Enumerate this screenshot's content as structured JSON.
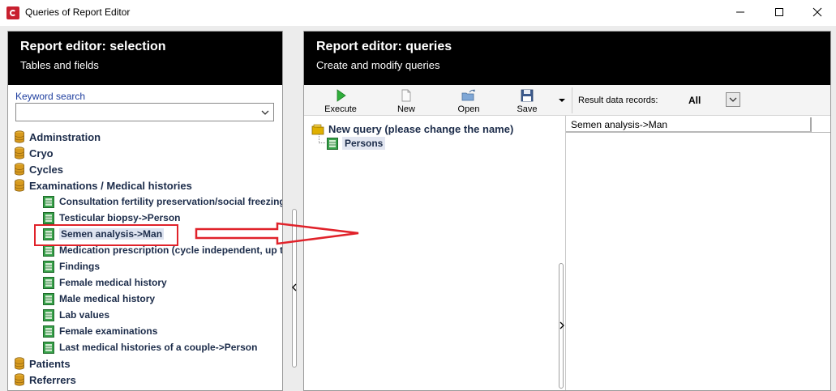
{
  "window": {
    "title": "Queries of Report Editor"
  },
  "left_panel": {
    "header_title": "Report editor: selection",
    "header_subtitle": "Tables and fields",
    "keyword_label": "Keyword search",
    "keyword_value": "",
    "tree": {
      "groups_top": [
        "Adminstration",
        "Cryo",
        "Cycles",
        "Examinations / Medical histories"
      ],
      "examination_tables": [
        "Consultation fertility preservation/social freezing",
        "Testicular biopsy->Person",
        "Semen analysis->Man",
        "Medication prescription (cycle independent, up to",
        "Findings",
        "Female medical history",
        "Male medical history",
        "Lab values",
        "Female examinations",
        "Last medical histories of a couple->Person"
      ],
      "groups_bottom": [
        "Patients",
        "Referrers"
      ],
      "selected_item": "Semen analysis->Man"
    }
  },
  "right_panel": {
    "header_title": "Report editor: queries",
    "header_subtitle": "Create and modify queries",
    "toolbar": {
      "execute_label": "Execute",
      "new_label": "New",
      "open_label": "Open",
      "save_label": "Save",
      "result_records_label": "Result data records:",
      "result_records_value": "All"
    },
    "query_tree": {
      "root_label": "New query (please change the name)",
      "child_label": "Persons"
    },
    "results": {
      "column_header": "Semen analysis->Man"
    }
  },
  "colors": {
    "panel_header_bg": "#000000",
    "highlight_red": "#e0222a",
    "execute_green": "#2fae3a",
    "tree_text": "#1c2c4a",
    "link_blue": "#1d3d9e"
  }
}
